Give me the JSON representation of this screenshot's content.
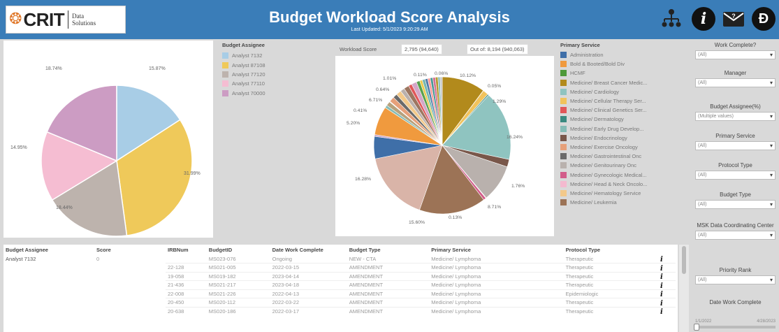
{
  "header": {
    "logo_text": "CRIT",
    "logo_sub1": "Data",
    "logo_sub2": "Solutions",
    "title": "Budget Workload Score Analysis",
    "subtitle": "Last Updated: 5/1/2023 9:20:29 AM",
    "icons": [
      "org-chart-icon",
      "info-icon",
      "mail-icon",
      "brand-icon"
    ]
  },
  "pie1": {
    "legend_title": "Budget Assignee",
    "legend": [
      {
        "label": "Analyst 7132",
        "color": "#a8cde6"
      },
      {
        "label": "Analyst 87108",
        "color": "#efc95a"
      },
      {
        "label": "Analyst 77120",
        "color": "#bdb3ad"
      },
      {
        "label": "Analyst 77110",
        "color": "#f5bdd2"
      },
      {
        "label": "Analyst 70000",
        "color": "#cc9cc3"
      }
    ],
    "labels": [
      "15.87%",
      "31.99%",
      "18.44%",
      "14.95%",
      "18.74%"
    ]
  },
  "workload": {
    "label": "Workload Score",
    "value": "2,795 (94,640)",
    "outof": "Out of: 8,194 (940,063)"
  },
  "pie2": {
    "labels": [
      "10.12%",
      "0.05%",
      "1.29%",
      "16.24%",
      "1.76%",
      "8.71%",
      "0.13%",
      "15.60%",
      "16.28%",
      "5.20%",
      "0.41%",
      "6.71%",
      "0.64%",
      "1.01%",
      "0.11%",
      "0.06%"
    ]
  },
  "primary_service": {
    "title": "Primary Service",
    "items": [
      {
        "label": "Administration",
        "color": "#3f6fa8"
      },
      {
        "label": "Bold & Booted/Bold Div",
        "color": "#f09a3e"
      },
      {
        "label": "HCMF",
        "color": "#4e9a3a"
      },
      {
        "label": "Medicine/ Breast Cancer Medic...",
        "color": "#b28a1c"
      },
      {
        "label": "Medicine/ Cardiology",
        "color": "#8fc4c0"
      },
      {
        "label": "Medicine/ Cellular Therapy Ser...",
        "color": "#f1c35c"
      },
      {
        "label": "Medicine/ Clinical Genetics Ser...",
        "color": "#e15759"
      },
      {
        "label": "Medicine/ Dermatology",
        "color": "#3a8a80"
      },
      {
        "label": "Medicine/ Early Drug Develop...",
        "color": "#86bcb6"
      },
      {
        "label": "Medicine/ Endocrinology",
        "color": "#79574a"
      },
      {
        "label": "Medicine/ Exercise Oncology",
        "color": "#e6a07a"
      },
      {
        "label": "Medicine/ Gastrointestinal Onc",
        "color": "#6a6a6a"
      },
      {
        "label": "Medicine/ Genitourinary Onc",
        "color": "#b9b1ad"
      },
      {
        "label": "Medicine/ Gynecologic Medical...",
        "color": "#d25c8a"
      },
      {
        "label": "Medicine/ Head & Neck Oncolo...",
        "color": "#f4b9cf"
      },
      {
        "label": "Medicine/ Hematology Service",
        "color": "#f3c98a"
      },
      {
        "label": "Medicine/ Leukemia",
        "color": "#9c7356"
      }
    ]
  },
  "filters": [
    {
      "title": "Work Complete?",
      "value": "(All)"
    },
    {
      "title": "Manager",
      "value": "(All)"
    },
    {
      "title": "Budget Assignee(%)",
      "value": "(Multiple values)"
    },
    {
      "title": "Primary Service",
      "value": "(All)"
    },
    {
      "title": "Protocol Type",
      "value": "(All)"
    },
    {
      "title": "Budget Type",
      "value": "(All)"
    },
    {
      "title": "MSK Data Coordinating Center",
      "value": "(All)"
    },
    {
      "title": "Priority Rank",
      "value": "(All)"
    },
    {
      "title": "Date Work Complete",
      "value": "1/1/2022"
    }
  ],
  "date_range_end": "4/28/2023",
  "table": {
    "left_headers": [
      "Budget Assignee",
      "Score"
    ],
    "left_row": [
      "Analyst 7132",
      "0"
    ],
    "headers": [
      "IRBNum",
      "BudgetID",
      "Date Work Complete",
      "Budget Type",
      "Primary Service",
      "Protocol Type"
    ],
    "rows": [
      [
        "",
        "MS023-076",
        "Ongoing",
        "NEW - CTA",
        "Medicine/ Lymphoma",
        "Therapeutic"
      ],
      [
        "22-128",
        "MS021-005",
        "2022-03-15",
        "AMENDMENT",
        "Medicine/ Lymphoma",
        "Therapeutic"
      ],
      [
        "19-058",
        "MS019-182",
        "2023-04-14",
        "AMENDMENT",
        "Medicine/ Lymphoma",
        "Therapeutic"
      ],
      [
        "21-436",
        "MS021-217",
        "2023-04-18",
        "AMENDMENT",
        "Medicine/ Lymphoma",
        "Therapeutic"
      ],
      [
        "22-008",
        "MS021-226",
        "2022-04-13",
        "AMENDMENT",
        "Medicine/ Lymphoma",
        "Epidemiologic"
      ],
      [
        "20-450",
        "MS020-112",
        "2022-03-22",
        "AMENDMENT",
        "Medicine/ Lymphoma",
        "Therapeutic"
      ],
      [
        "20-638",
        "MS020-186",
        "2022-03-17",
        "AMENDMENT",
        "Medicine/ Lymphoma",
        "Therapeutic"
      ]
    ]
  }
}
